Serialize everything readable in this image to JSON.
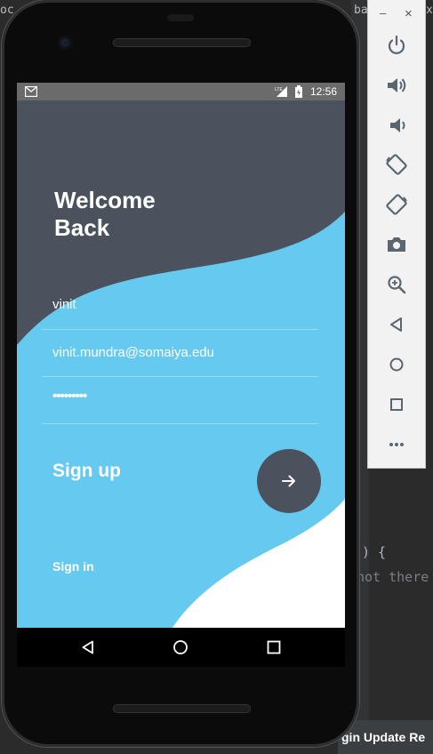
{
  "ide": {
    "tab_fragment_left": "oc",
    "tab_fragment_right": "ba",
    "tab_close": "x",
    "code_line_1": ") {",
    "code_line_2": "not there",
    "status_text": "gin Update Re"
  },
  "device": {
    "status_time": "12:56"
  },
  "screen": {
    "title_line1": "Welcome",
    "title_line2": "Back",
    "name_value": "vinit",
    "email_value": "vinit.mundra@somaiya.edu",
    "password_value": "•••••••••",
    "signup_label": "Sign up",
    "signin_label": "Sign in",
    "colors": {
      "dark": "#4c525d",
      "accent": "#66c9ef",
      "white": "#ffffff"
    }
  },
  "emulator_panel": {
    "minimize_label": "–",
    "close_label": "×",
    "buttons": [
      "power-icon",
      "volume-up-icon",
      "volume-down-icon",
      "rotate-left-icon",
      "rotate-right-icon",
      "camera-icon",
      "zoom-icon",
      "back-icon",
      "home-icon",
      "overview-icon",
      "more-icon"
    ]
  }
}
